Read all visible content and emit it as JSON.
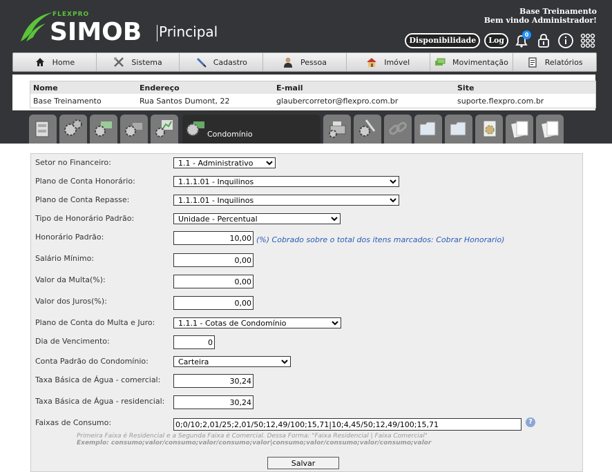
{
  "header": {
    "brand_small": "FLEXPRO",
    "brand": "SIMOB",
    "section": "Principal",
    "user_line1": "Base Treinamento",
    "user_line2": "Bem vindo Administrador!",
    "availability_label": "Disponibilidade",
    "log_label": "Log",
    "notification_count": "0"
  },
  "menu": {
    "items": [
      {
        "label": "Home",
        "icon": "home-icon"
      },
      {
        "label": "Sistema",
        "icon": "tools-icon"
      },
      {
        "label": "Cadastro",
        "icon": "pen-icon"
      },
      {
        "label": "Pessoa",
        "icon": "person-icon"
      },
      {
        "label": "Imóvel",
        "icon": "house-icon"
      },
      {
        "label": "Movimentação",
        "icon": "money-icon"
      },
      {
        "label": "Relatórios",
        "icon": "report-icon"
      }
    ]
  },
  "info": {
    "headers": [
      "Nome",
      "Endereço",
      "E-mail",
      "Site"
    ],
    "values": [
      "Base Treinamento",
      "Rua Santos Dumont, 22",
      "glaubercorretor@flexpro.com.br",
      "suporte.flexpro.com.br"
    ]
  },
  "tabs": {
    "active_label": "Condomínio"
  },
  "form": {
    "setor_label": "Setor no Financeiro:",
    "setor_value": "1.1 - Administrativo",
    "plano_honorario_label": "Plano de Conta Honorário:",
    "plano_honorario_value": "1.1.1.01 - Inquilinos",
    "plano_repasse_label": "Plano de Conta Repasse:",
    "plano_repasse_value": "1.1.1.01 - Inquilinos",
    "tipo_honorario_label": "Tipo de Honorário Padrão:",
    "tipo_honorario_value": "Unidade - Percentual",
    "honorario_label": "Honorário Padrão:",
    "honorario_value": "10,00",
    "honorario_hint": "(%) Cobrado sobre o total dos itens marcados: Cobrar Honorario)",
    "salario_label": "Salário Mínimo:",
    "salario_value": "0,00",
    "multa_label": "Valor da Multa(%):",
    "multa_value": "0,00",
    "juros_label": "Valor dos Juros(%):",
    "juros_value": "0,00",
    "plano_multa_label": "Plano de Conta do Multa e Juro:",
    "plano_multa_value": "1.1.1 - Cotas de Condomínio",
    "vencimento_label": "Dia de Vencimento:",
    "vencimento_value": "0",
    "conta_padrao_label": "Conta Padrão do Condomínio:",
    "conta_padrao_value": "Carteira",
    "agua_com_label": "Taxa Básica de Água - comercial:",
    "agua_com_value": "30,24",
    "agua_res_label": "Taxa Básica de Água - residencial:",
    "agua_res_value": "30,24",
    "faixas_label": "Faixas de Consumo:",
    "faixas_value": "0;0/10;2,01/25;2,01/50;12,49/100;15,71|10;4,45/50;12,49/100;15,71",
    "faixas_note1": "Primeira Faixa é Residencial e a Segunda Faixa é Comercial. Dessa Forma: \"Faixa Residencial | Faixa Comercial\"",
    "faixas_note2": "Exemplo: consumo;valor/consumo;valor/consumo;valor|consumo;valor/consumo;valor/consumo;valor",
    "save_label": "Salvar"
  }
}
